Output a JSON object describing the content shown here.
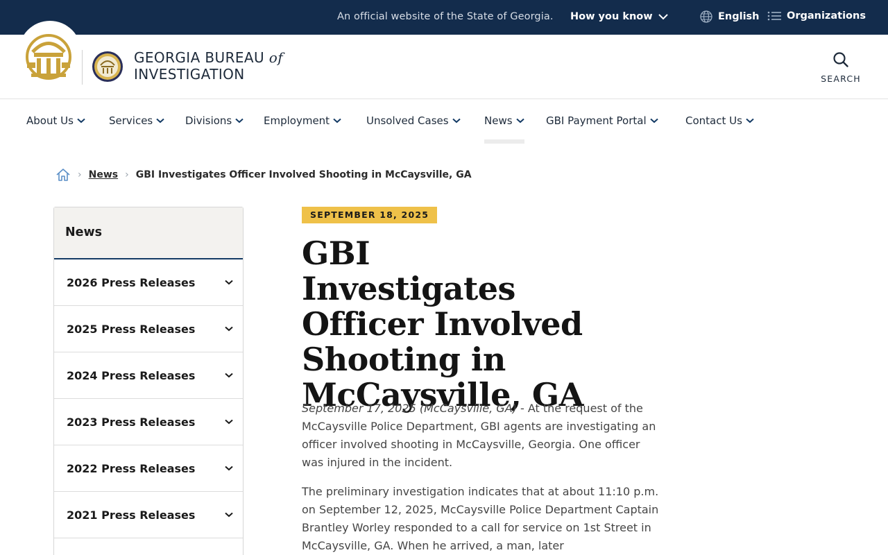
{
  "topbar": {
    "official_text": "An official website of the State of Georgia.",
    "how_you_know": "How you know",
    "language": "English",
    "organizations": "Organizations"
  },
  "header": {
    "brand_line1": "GEORGIA BUREAU",
    "brand_of": "of",
    "brand_line2": "INVESTIGATION",
    "search_label": "SEARCH"
  },
  "nav": {
    "items": [
      {
        "label": "About Us"
      },
      {
        "label": "Services"
      },
      {
        "label": "Divisions"
      },
      {
        "label": "Employment"
      },
      {
        "label": "Unsolved Cases"
      },
      {
        "label": "News"
      },
      {
        "label": "GBI Payment Portal"
      },
      {
        "label": "Contact Us"
      }
    ],
    "active": "News"
  },
  "breadcrumb": {
    "link": "News",
    "current": "GBI Investigates Officer Involved Shooting in McCaysville, GA"
  },
  "sidebar": {
    "heading": "News",
    "items": [
      {
        "label": "2026 Press Releases"
      },
      {
        "label": "2025 Press Releases"
      },
      {
        "label": "2024 Press Releases"
      },
      {
        "label": "2023 Press Releases"
      },
      {
        "label": "2022 Press Releases"
      },
      {
        "label": "2021 Press Releases"
      }
    ]
  },
  "article": {
    "date_badge": "SEPTEMBER 18, 2025",
    "title": "GBI Investigates Officer Involved Shooting in McCaysville, GA",
    "dateline": "September 17, 2025 (McCaysville, GA)",
    "para1_rest": " - At the request of the McCaysville Police Department, GBI agents are investigating an officer involved shooting in McCaysville, Georgia. One officer was injured in the incident.",
    "para2": "The preliminary investigation indicates that at about 11:10 p.m. on September 12, 2025, McCaysville Police Department Captain Brantley Worley responded to a call for service on 1st Street in McCaysville, GA. When he arrived, a man, later"
  },
  "colors": {
    "topbar_bg": "#132c4c",
    "badge_gold": "#efc149",
    "seal_gold": "#c9a23a"
  }
}
